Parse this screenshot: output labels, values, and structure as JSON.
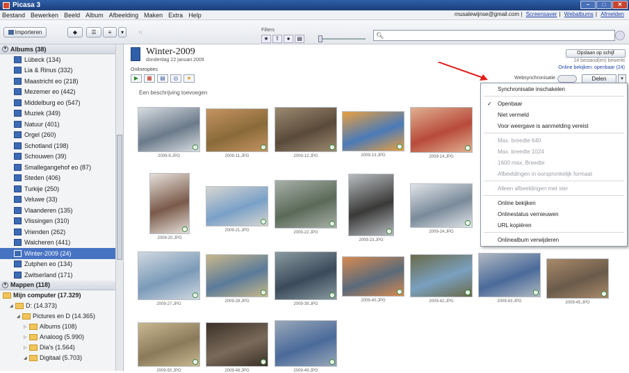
{
  "window": {
    "title": "Picasa 3"
  },
  "menubar": {
    "items": [
      "Bestand",
      "Bewerken",
      "Beeld",
      "Album",
      "Afbeelding",
      "Maken",
      "Extra",
      "Help"
    ],
    "account_email": "rnusalewijnse@gmail.com",
    "links": [
      "Screensaver",
      "Webalbums",
      "Afmelden"
    ]
  },
  "toolbar": {
    "import_label": "Importeren",
    "filters_label": "Filters",
    "search_placeholder": ""
  },
  "sidebar": {
    "albums_header": "Albums (38)",
    "albums": [
      "Lübeck (134)",
      "Lia & Rinus (332)",
      "Maastricht eo (218)",
      "Mezemer eo (442)",
      "Middelburg eo (547)",
      "Muziek (349)",
      "Natuur (401)",
      "Orgel (260)",
      "Schotland (198)",
      "Schouwen (39)",
      "Smallegangehof eo (87)",
      "Steden (406)",
      "Turkije (250)",
      "Veluwe (33)",
      "Vlaanderen (135)",
      "Vlissingen (310)",
      "Vrienden (262)",
      "Walcheren (441)",
      "Winter-2009 (24)",
      "Zutphen eo (134)",
      "Zwitserland (171)"
    ],
    "selected_album_index": 18,
    "folders_header": "Mappen (118)",
    "folders": [
      {
        "label": "Mijn computer (17.329)",
        "indent": 0
      },
      {
        "label": "D: (14.373)",
        "indent": 1
      },
      {
        "label": "Pictures en D (14.365)",
        "indent": 2
      },
      {
        "label": "Albums (108)",
        "indent": 3
      },
      {
        "label": "Analoog (5.990)",
        "indent": 3
      },
      {
        "label": "Dia's (1.564)",
        "indent": 3
      },
      {
        "label": "Digitaal (5.703)",
        "indent": 3
      }
    ]
  },
  "album": {
    "title": "Winter-2009",
    "date": "donderdag 22 januari 2009",
    "online_options": "Onlineopties",
    "save_button": "Opslaan op schijf",
    "photo_count": "24 bestand(en) bewerkt",
    "online_view": "Online bekijken: openbaar (24)",
    "web_sync_label": "Websynchronisatie",
    "delen_button": "Delen",
    "description_placeholder": "Een beschrijving toevoegen"
  },
  "thumbnails": [
    {
      "caption": "2009-9.JPG",
      "color1": "#6b7a8a",
      "color2": "#d8dde2"
    },
    {
      "caption": "2009-11.JPG",
      "color1": "#8a6a3a",
      "color2": "#c49460"
    },
    {
      "caption": "2009-12.JPG",
      "color1": "#5a4a3a",
      "color2": "#9b8a70"
    },
    {
      "caption": "2009-13.JPG",
      "color1": "#4a7ab8",
      "color2": "#e8a040"
    },
    {
      "caption": "2009-14.JPG",
      "color1": "#b84a3a",
      "color2": "#e0b090"
    },
    {
      "caption": "2009-20.JPG",
      "color1": "#7a5a4a",
      "color2": "#e6e0da"
    },
    {
      "caption": "2009-21.JPG",
      "color1": "#7aa0c8",
      "color2": "#d6d6d0"
    },
    {
      "caption": "2009-22.JPG",
      "color1": "#5a6a58",
      "color2": "#a8b0a8"
    },
    {
      "caption": "2009-23.JPG",
      "color1": "#3a3a38",
      "color2": "#b8bcc0"
    },
    {
      "caption": "2009-24.JPG",
      "color1": "#7a8a9a",
      "color2": "#e0e4e8"
    },
    {
      "caption": "2009-27.JPG",
      "color1": "#7a9ab8",
      "color2": "#d0d8e0"
    },
    {
      "caption": "2009-28.JPG",
      "color1": "#5a7a9a",
      "color2": "#c8b88a"
    },
    {
      "caption": "2009-39.JPG",
      "color1": "#3a4a5a",
      "color2": "#8a9aa0"
    },
    {
      "caption": "2009-40.JPG",
      "color1": "#5a6a7a",
      "color2": "#d88a50"
    },
    {
      "caption": "2009-42.JPG",
      "color1": "#7aa0c0",
      "color2": "#6a6a48"
    },
    {
      "caption": "2009-43.JPG",
      "color1": "#4a6a9a",
      "color2": "#b0b8c0"
    },
    {
      "caption": "2009-45.JPG",
      "color1": "#6a5a4a",
      "color2": "#a88a6a"
    },
    {
      "caption": "2009-50.JPG",
      "color1": "#8a7a5a",
      "color2": "#c8b890"
    },
    {
      "caption": "2009-48.JPG",
      "color1": "#7a6a5a",
      "color2": "#3a3028"
    },
    {
      "caption": "2009-49.JPG",
      "color1": "#4a6a9a",
      "color2": "#9aa8b8"
    }
  ],
  "context_menu": {
    "items": [
      {
        "label": "Synchronisatie inschakelen",
        "enabled": true,
        "checked": false
      },
      {
        "sep": true
      },
      {
        "label": "Openbaar",
        "enabled": true,
        "checked": true
      },
      {
        "label": "Niet vermeld",
        "enabled": true,
        "checked": false
      },
      {
        "label": "Voor weergave is aanmelding vereist",
        "enabled": true,
        "checked": false
      },
      {
        "sep": true
      },
      {
        "label": "Max. breedte 640",
        "enabled": false,
        "checked": false
      },
      {
        "label": "Max. breedte 1024",
        "enabled": false,
        "checked": false
      },
      {
        "label": "1600 max. Breedte",
        "enabled": false,
        "checked": false
      },
      {
        "label": "Afbeeldingen in oorspronkelijk formaat",
        "enabled": false,
        "checked": false
      },
      {
        "sep": true
      },
      {
        "label": "Alleen afbeeldingen met ster",
        "enabled": false,
        "checked": false
      },
      {
        "sep": true
      },
      {
        "label": "Online bekijken",
        "enabled": true,
        "checked": false
      },
      {
        "label": "Onlinestatus vernieuwen",
        "enabled": true,
        "checked": false
      },
      {
        "label": "URL kopiëren",
        "enabled": true,
        "checked": false
      },
      {
        "sep": true
      },
      {
        "label": "Onlinealbum verwijderen",
        "enabled": true,
        "checked": false
      }
    ]
  },
  "colors": {
    "accent": "#4773c3",
    "annotation_arrow": "#e0201c"
  }
}
